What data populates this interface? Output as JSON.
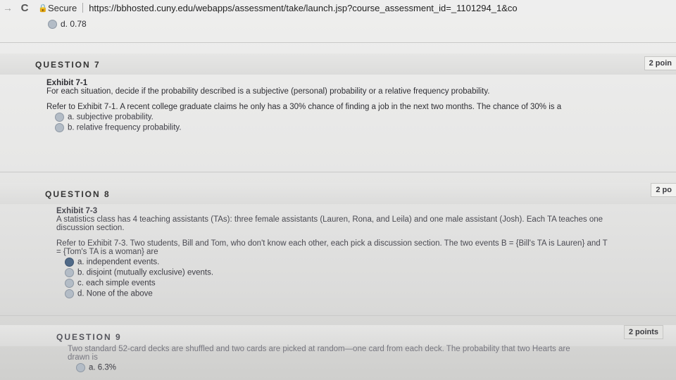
{
  "browser": {
    "secure_label": "Secure",
    "url": "https://bbhosted.cuny.edu/webapps/assessment/take/launch.jsp?course_assessment_id=_1101294_1&co"
  },
  "previous_answer": "d. 0.78",
  "questions": [
    {
      "title": "QUESTION 7",
      "points": "2 poin",
      "exhibit": "Exhibit 7-1",
      "instruction": "For each situation, decide if the probability described is a subjective (personal) probability or a relative frequency probability.",
      "prompt": "Refer to Exhibit 7-1. A recent college graduate claims he only has a 30% chance of finding a job in the next two months. The chance of 30% is a",
      "options": [
        "a. subjective probability.",
        "b. relative frequency probability."
      ]
    },
    {
      "title": "QUESTION 8",
      "points": "2 po",
      "exhibit": "Exhibit 7-3",
      "instruction": "A statistics class has 4 teaching assistants (TAs): three female assistants (Lauren, Rona, and Leila) and one male assistant (Josh). Each TA teaches one discussion section.",
      "prompt": "Refer to Exhibit 7-3. Two students, Bill and Tom, who don't know each other, each pick a discussion section. The two events B = {Bill's TA is Lauren} and T = {Tom's TA is a woman} are",
      "options": [
        "a. independent events.",
        "b. disjoint (mutually exclusive) events.",
        "c. each simple events",
        "d. None of the above"
      ],
      "selected_index": 0
    },
    {
      "title": "QUESTION 9",
      "points": "2 points",
      "prompt": "Two standard 52-card decks are shuffled and two cards are picked at random—one card from each deck. The probability that two Hearts are drawn is",
      "options": [
        "a. 6.3%"
      ]
    }
  ]
}
